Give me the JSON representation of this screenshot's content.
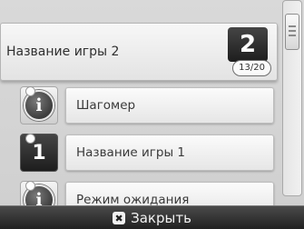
{
  "list": {
    "selected": {
      "label": "Название игры 2",
      "badge_number": "2",
      "count": "13/20"
    },
    "items": [
      {
        "label": "Шагомер",
        "icon": "info-icon"
      },
      {
        "label": "Название игры 1",
        "icon_number": "1"
      },
      {
        "label": "Режим ожидания",
        "icon": "info-icon"
      }
    ]
  },
  "bottom_bar": {
    "close_label": "Закрыть",
    "close_glyph": "✖"
  },
  "icons": {
    "info_glyph": "i"
  },
  "colors": {
    "background": "#d6d6d6",
    "bottom_bar": "#2b2b2b",
    "tile_dark": "#2a2a2a"
  }
}
